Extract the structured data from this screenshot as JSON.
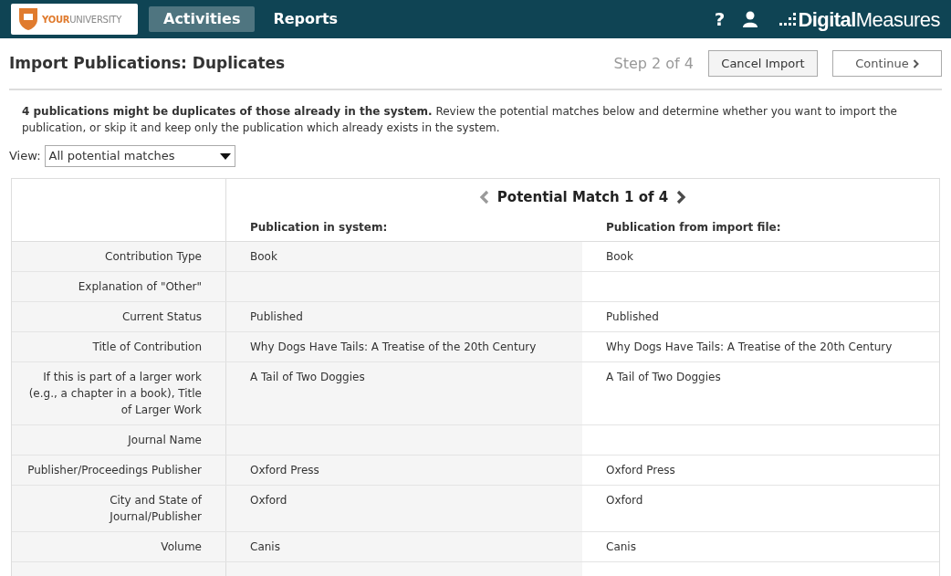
{
  "header": {
    "logo": {
      "strong": "YOUR",
      "light": "UNIVERSITY"
    },
    "tabs": [
      {
        "label": "Activities",
        "selected": true
      },
      {
        "label": "Reports",
        "selected": false
      }
    ],
    "help": "?",
    "brand": "**Digital**Measures"
  },
  "page": {
    "title": "Import Publications: Duplicates",
    "step": "Step 2 of 4",
    "buttons": [
      {
        "label": "Cancel Import",
        "kind": "plain"
      },
      {
        "label": "Continue",
        "kind": "next"
      }
    ]
  },
  "intro": "**4 publications might be duplicates of those already in the system.** Review the potential matches below and determine whether you want to import the publication, or skip it and keep only the publication which already exists in the system.",
  "view": {
    "label": "View:",
    "value": "All potential matches"
  },
  "match": {
    "title": "Potential Match 1 of 4",
    "prev_disabled": true,
    "next_disabled": false,
    "columns": [
      "Publication in system:",
      "Publication from import file:"
    ],
    "rows": [
      {
        "label": "Contribution Type",
        "system": "Book",
        "import": "Book"
      },
      {
        "label": "Explanation of \"Other\"",
        "system": "",
        "import": ""
      },
      {
        "label": "Current Status",
        "system": "Published",
        "import": "Published"
      },
      {
        "label": "Title of Contribution",
        "system": "Why Dogs Have Tails: A Treatise of the 20th Century",
        "import": "Why Dogs Have Tails: A Treatise of the 20th Century"
      },
      {
        "label": "If this is part of a larger work (e.g., a chapter in a book), Title of Larger Work",
        "system": "A Tail of Two Doggies",
        "import": "A Tail of Two Doggies"
      },
      {
        "label": "Journal Name",
        "system": "",
        "import": ""
      },
      {
        "label": "Publisher/Proceedings Publisher",
        "system": "Oxford Press",
        "import": "Oxford Press"
      },
      {
        "label": "City and State of Journal/Publisher",
        "system": "Oxford",
        "import": "Oxford"
      },
      {
        "label": "Volume",
        "system": "Canis",
        "import": "Canis"
      }
    ]
  }
}
